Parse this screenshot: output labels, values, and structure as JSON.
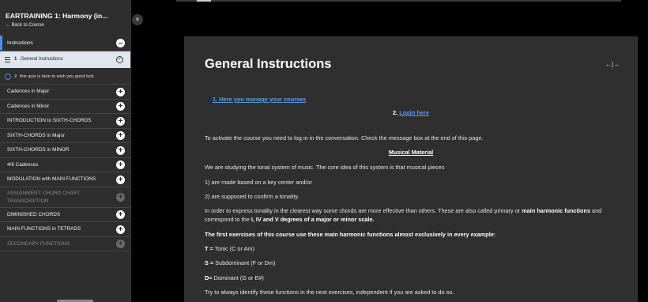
{
  "sidebar": {
    "course_title": "EARTRAINING 1: Harmony (in...",
    "back_link": "← Back to Course",
    "close_glyph": "×",
    "instructions_label": "Instructions",
    "lessons": [
      {
        "number": "1",
        "label": "General Instructions",
        "active": true
      },
      {
        "number": "2",
        "label": "this quiz is here to wish you good luck",
        "active": false
      }
    ],
    "sections": [
      {
        "label": "Cadences in Major",
        "disabled": false
      },
      {
        "label": "Cadences in Minor",
        "disabled": false
      },
      {
        "label": "INTRODUCTION to SIXTH-CHORDS",
        "disabled": false
      },
      {
        "label": "SIXTH-CHORDS in Major",
        "disabled": false
      },
      {
        "label": "SIXTH-CHORDS in MINOR",
        "disabled": false
      },
      {
        "label": "4/6 Cadences",
        "disabled": false
      },
      {
        "label": "MODULATION with MAIN FUNCTIONS",
        "disabled": false
      },
      {
        "label": "ASSIGNMENT: CHORD CHART",
        "label2": "TRANSCRIPTION",
        "disabled": true
      },
      {
        "label": "DIMINISHED CHORDS",
        "disabled": false
      },
      {
        "label": "MAIN FUNCTIONS in TETRADS",
        "disabled": false
      },
      {
        "label": "SECONDARY FUNCTIONS",
        "disabled": true
      }
    ]
  },
  "content": {
    "title": "General Instructions",
    "link1": "1. Here you manage your courses",
    "link2_prefix": "2. ",
    "link2": "Login here",
    "para1": "To activate the course you need to log in in the conversation. Check the message box at the end of this page.",
    "heading_material": "Musical Material",
    "para2": "We are studying the tonal system of music. The core idea of this system is that musical pieces",
    "item1": "1) are made based on a key center and/or",
    "item2": "2) are supposed to confirm a tonality.",
    "para3a": "In order to express tonality in the clearest way some chords are more effective than others. These are also called primary or ",
    "para3b": "main harmonic functions",
    "para3c": " and",
    "para3d": "correspond to the ",
    "para3e": "I, IV and V degrees of a major or minor scale.",
    "para4": "The first exercises of this course use these main harmonic functions almost exclusively in every example:",
    "t_key": "T =",
    "t_val": " Tonic (C or Am)",
    "s_key": "S =",
    "s_val": " Subdominant (F or Dm)",
    "d_key": "D=",
    "d_val": " Dominant (G or E#)",
    "para5": "Try to always identify these functions in the next exercises, independent if you are asked to do so."
  },
  "icons": {
    "expand": "←|→",
    "plus": "+",
    "check": "✓"
  }
}
